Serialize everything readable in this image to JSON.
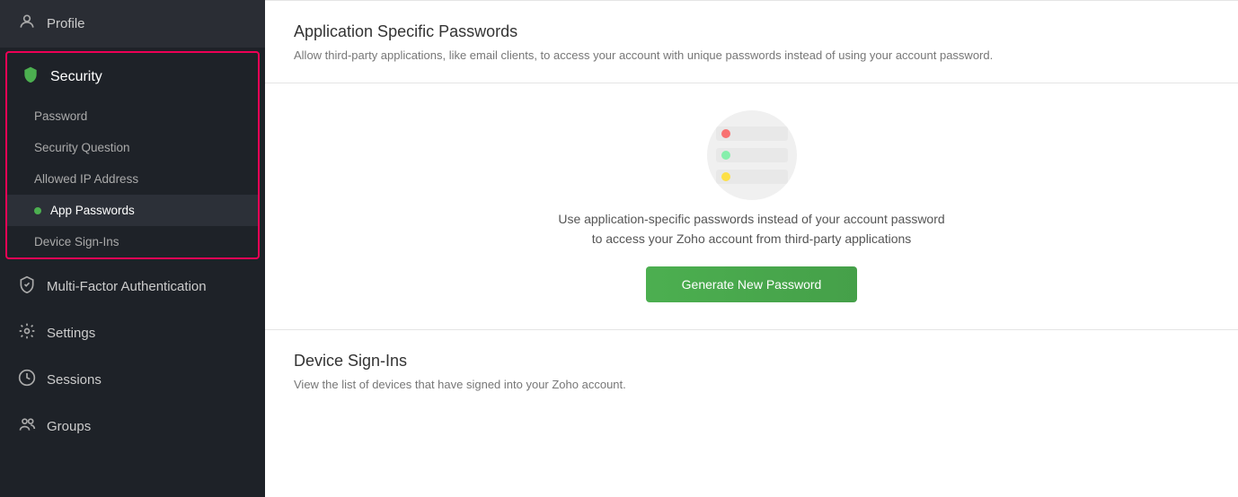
{
  "sidebar": {
    "profile_label": "Profile",
    "security_label": "Security",
    "sub_items": [
      {
        "id": "password",
        "label": "Password",
        "active": false,
        "dot": false
      },
      {
        "id": "security-question",
        "label": "Security Question",
        "active": false,
        "dot": false
      },
      {
        "id": "allowed-ip",
        "label": "Allowed IP Address",
        "active": false,
        "dot": false
      },
      {
        "id": "app-passwords",
        "label": "App Passwords",
        "active": true,
        "dot": true
      },
      {
        "id": "device-signins",
        "label": "Device Sign-Ins",
        "active": false,
        "dot": false
      }
    ],
    "mfa_label": "Multi-Factor Authentication",
    "settings_label": "Settings",
    "sessions_label": "Sessions",
    "groups_label": "Groups"
  },
  "main": {
    "app_passwords": {
      "title": "Application Specific Passwords",
      "description": "Allow third-party applications, like email clients, to access your account with unique passwords instead of using your account password.",
      "visual_text_line1": "Use application-specific passwords instead of your account password",
      "visual_text_line2": "to access your Zoho account from third-party applications",
      "generate_btn_label": "Generate New Password"
    },
    "device_signins": {
      "title": "Device Sign-Ins",
      "description": "View the list of devices that have signed into your Zoho account."
    }
  }
}
